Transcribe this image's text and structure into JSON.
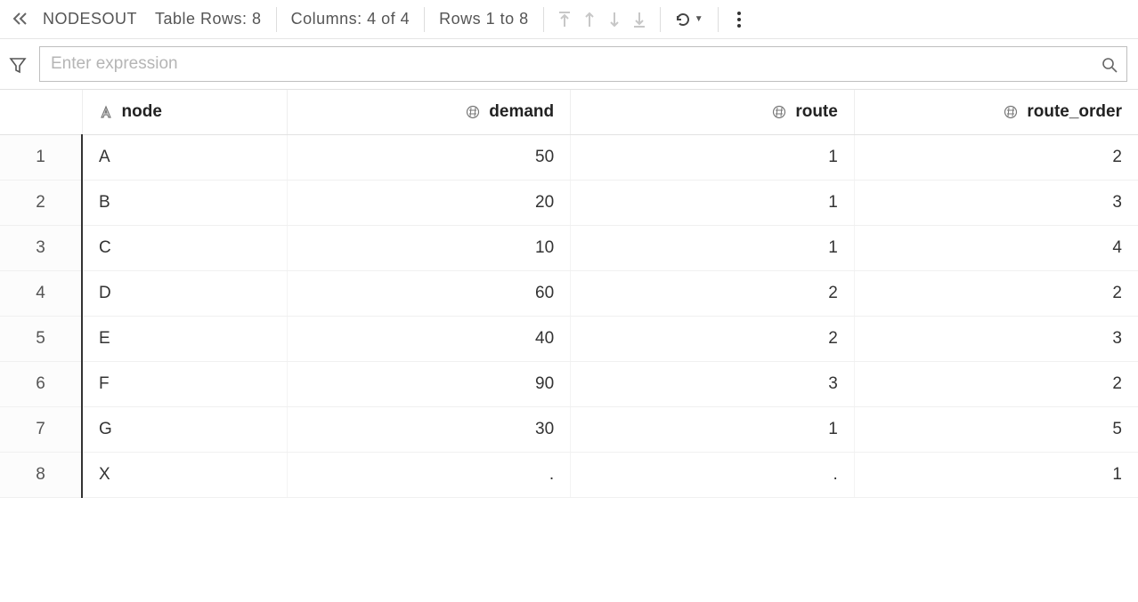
{
  "toolbar": {
    "dataset_name": "NODESOUT",
    "table_rows_label": "Table Rows: 8",
    "columns_label": "Columns: 4 of 4",
    "rows_range_label": "Rows 1 to 8"
  },
  "filter": {
    "placeholder": "Enter expression"
  },
  "columns": [
    {
      "key": "node",
      "label": "node",
      "type": "char",
      "align": "left"
    },
    {
      "key": "demand",
      "label": "demand",
      "type": "num",
      "align": "right"
    },
    {
      "key": "route",
      "label": "route",
      "type": "num",
      "align": "right"
    },
    {
      "key": "route_order",
      "label": "route_order",
      "type": "num",
      "align": "right"
    }
  ],
  "rows": [
    {
      "n": "1",
      "node": "A",
      "demand": "50",
      "route": "1",
      "route_order": "2"
    },
    {
      "n": "2",
      "node": "B",
      "demand": "20",
      "route": "1",
      "route_order": "3"
    },
    {
      "n": "3",
      "node": "C",
      "demand": "10",
      "route": "1",
      "route_order": "4"
    },
    {
      "n": "4",
      "node": "D",
      "demand": "60",
      "route": "2",
      "route_order": "2"
    },
    {
      "n": "5",
      "node": "E",
      "demand": "40",
      "route": "2",
      "route_order": "3"
    },
    {
      "n": "6",
      "node": "F",
      "demand": "90",
      "route": "3",
      "route_order": "2"
    },
    {
      "n": "7",
      "node": "G",
      "demand": "30",
      "route": "1",
      "route_order": "5"
    },
    {
      "n": "8",
      "node": "X",
      "demand": ".",
      "route": ".",
      "route_order": "1"
    }
  ]
}
